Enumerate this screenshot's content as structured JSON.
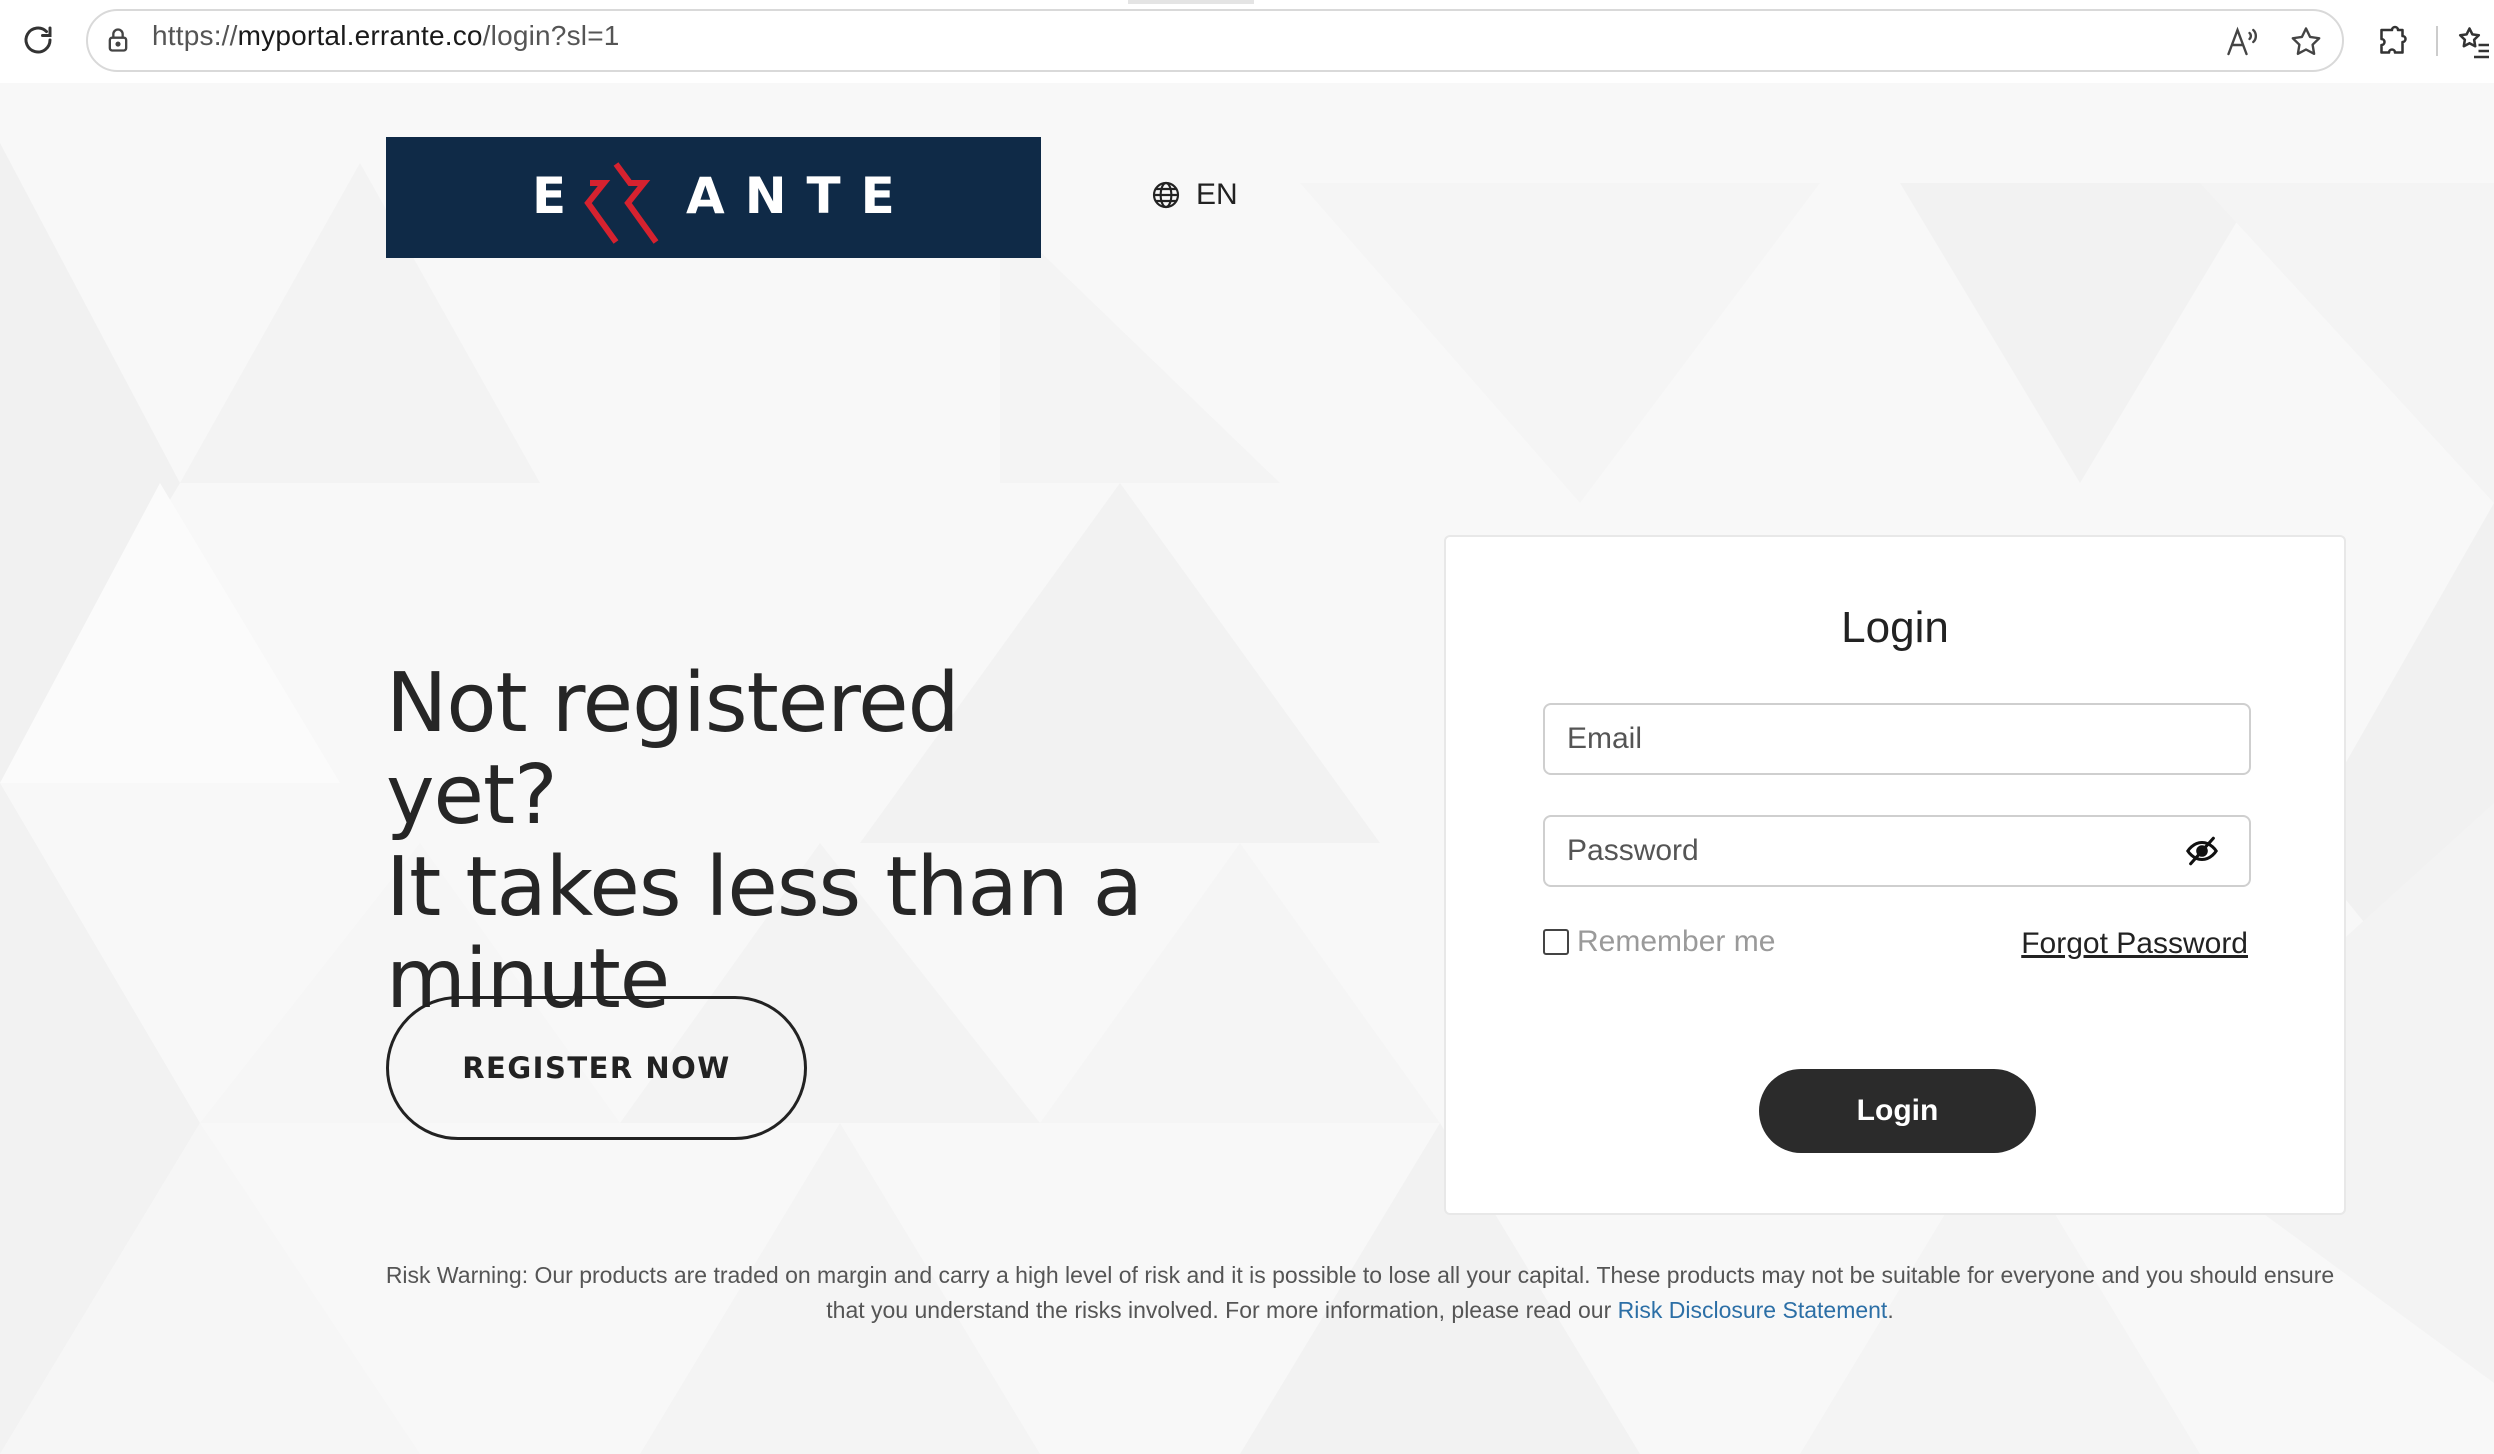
{
  "browser": {
    "url_prefix": "https://",
    "url_host": "myportal.errante.co",
    "url_path": "/login?sl=1"
  },
  "header": {
    "logo_text": "ERRANTE",
    "language": "EN"
  },
  "hero": {
    "headline_line1": "Not registered yet?",
    "headline_line2": "It takes less than a",
    "headline_line3": "minute",
    "register_label": "REGISTER NOW"
  },
  "login": {
    "title": "Login",
    "email_placeholder": "Email",
    "password_placeholder": "Password",
    "remember_label": "Remember me",
    "forgot_label": "Forgot Password",
    "submit_label": "Login"
  },
  "footer": {
    "risk_text": "Risk Warning: Our products are traded on margin and carry a high level of risk and it is possible to lose all your capital. These products may not be suitable for everyone and you should ensure that you understand the risks involved. For more information, please read our ",
    "risk_link": "Risk Disclosure Statement",
    "risk_end": "."
  },
  "colors": {
    "logo_bg": "#0f2a47",
    "logo_accent": "#d6222f",
    "button_dark": "#2b2b2b",
    "link_blue": "#2c6fa6"
  },
  "icons": {
    "reload": "reload-icon",
    "lock": "lock-icon",
    "read_aloud": "read-aloud-icon",
    "favorite": "star-icon",
    "extensions": "puzzle-icon",
    "favorites": "favorites-icon",
    "globe": "globe-icon",
    "eye": "eye-off-icon"
  }
}
